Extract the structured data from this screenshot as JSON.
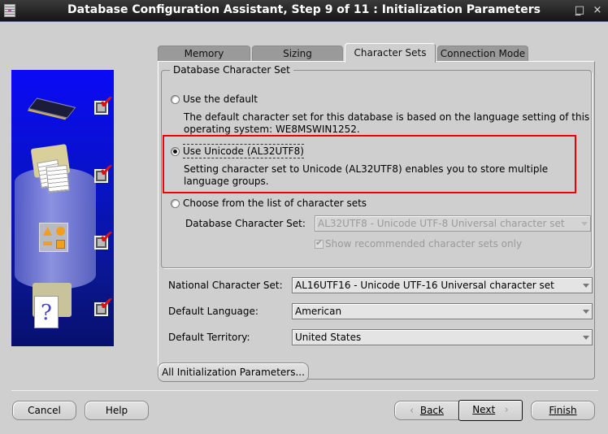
{
  "window": {
    "title": "Database Configuration Assistant, Step 9 of 11 : Initialization Parameters",
    "controls": {
      "minimize": "_",
      "maximize": "□",
      "close": "×"
    }
  },
  "tabs": [
    {
      "label": "Memory",
      "active": false
    },
    {
      "label": "Sizing",
      "active": false
    },
    {
      "label": "Character Sets",
      "active": true
    },
    {
      "label": "Connection Mode",
      "active": false
    }
  ],
  "database_character_set": {
    "legend": "Database Character Set",
    "options": [
      {
        "label": "Use the default",
        "selected": false,
        "description": "The default character set for this database is based on the language setting of this operating system: WE8MSWIN1252."
      },
      {
        "label": "Use Unicode (AL32UTF8)",
        "selected": true,
        "description": "Setting character set to Unicode (AL32UTF8) enables you to store multiple language groups."
      },
      {
        "label": "Choose from the list of character sets",
        "selected": false
      }
    ],
    "charset_field": {
      "label": "Database Character Set:",
      "value": "AL32UTF8 - Unicode UTF-8 Universal character set",
      "enabled": false
    },
    "recommended_checkbox": {
      "label": "Show recommended character sets only",
      "checked": true,
      "enabled": false
    }
  },
  "fields": [
    {
      "label": "National Character Set:",
      "value": "AL16UTF16 - Unicode UTF-16 Universal character set"
    },
    {
      "label": "Default Language:",
      "value": "American"
    },
    {
      "label": "Default Territory:",
      "value": "United States"
    }
  ],
  "buttons": {
    "all_params": "All Initialization Parameters...",
    "cancel": "Cancel",
    "help": "Help",
    "back": "Back",
    "next": "Next",
    "finish": "Finish"
  },
  "side_steps": [
    {
      "icon": "memory-chip",
      "completed": true
    },
    {
      "icon": "storage-files",
      "completed": true
    },
    {
      "icon": "shapes-options",
      "completed": true
    },
    {
      "icon": "help-documents",
      "completed": true
    }
  ],
  "highlight_color": "#e00000"
}
